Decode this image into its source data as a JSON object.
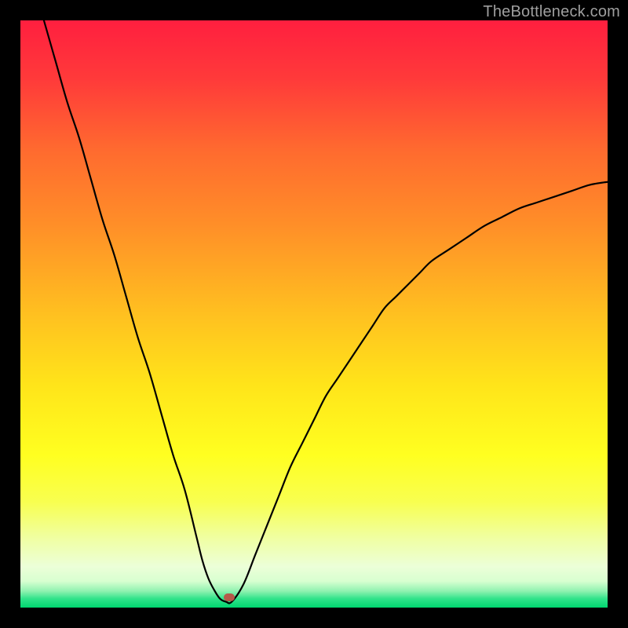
{
  "watermark": "TheBottleneck.com",
  "chart_data": {
    "type": "line",
    "title": "",
    "xlabel": "",
    "ylabel": "",
    "xlim": [
      0,
      100
    ],
    "ylim": [
      0,
      100
    ],
    "grid": false,
    "series": [
      {
        "name": "bottleneck-curve",
        "x": [
          4,
          6,
          8,
          10,
          12,
          14,
          16,
          18,
          20,
          22,
          24,
          26,
          28,
          30,
          31,
          32,
          33,
          34,
          35,
          36,
          38,
          40,
          42,
          44,
          46,
          48,
          50,
          52,
          54,
          56,
          58,
          60,
          62,
          64,
          66,
          68,
          70,
          73,
          76,
          79,
          82,
          85,
          88,
          91,
          94,
          97,
          100
        ],
        "y": [
          100,
          93,
          86,
          80,
          73,
          66,
          60,
          53,
          46,
          40,
          33,
          26,
          20,
          12,
          8,
          5,
          3,
          1.5,
          1.0,
          1.0,
          4,
          9,
          14,
          19,
          24,
          28,
          32,
          36,
          39,
          42,
          45,
          48,
          51,
          53,
          55,
          57,
          59,
          61,
          63,
          65,
          66.5,
          68,
          69,
          70,
          71,
          72,
          72.5
        ]
      }
    ],
    "marker": {
      "x": 35.5,
      "y": 1.8
    },
    "gradient_stops": [
      {
        "offset": 0.0,
        "color": "#ff1f3f"
      },
      {
        "offset": 0.1,
        "color": "#ff3a3a"
      },
      {
        "offset": 0.22,
        "color": "#ff6a2f"
      },
      {
        "offset": 0.35,
        "color": "#ff8f28"
      },
      {
        "offset": 0.5,
        "color": "#ffc020"
      },
      {
        "offset": 0.62,
        "color": "#ffe41a"
      },
      {
        "offset": 0.74,
        "color": "#ffff20"
      },
      {
        "offset": 0.82,
        "color": "#f8ff50"
      },
      {
        "offset": 0.88,
        "color": "#f0ffa0"
      },
      {
        "offset": 0.93,
        "color": "#ecffd8"
      },
      {
        "offset": 0.955,
        "color": "#d8ffd0"
      },
      {
        "offset": 0.972,
        "color": "#8ff2b0"
      },
      {
        "offset": 0.985,
        "color": "#30e38a"
      },
      {
        "offset": 1.0,
        "color": "#00d66f"
      }
    ]
  }
}
